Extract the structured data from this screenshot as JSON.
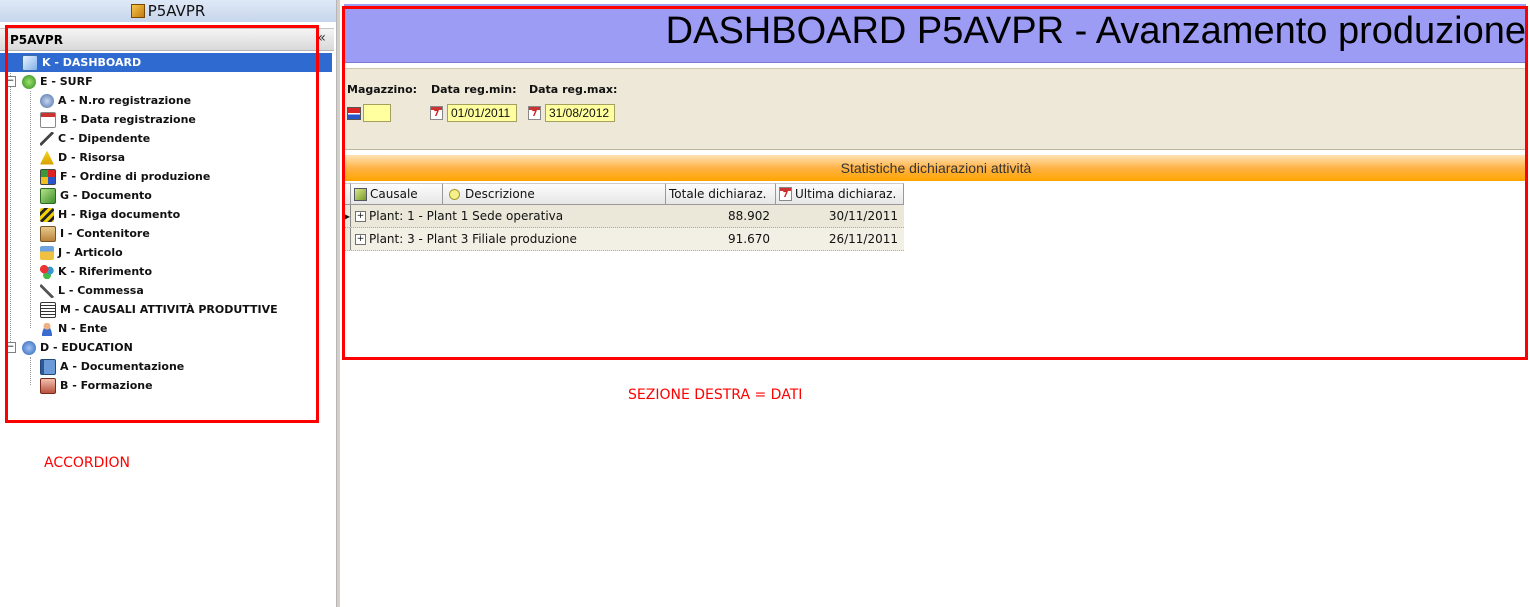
{
  "app": {
    "title": "P5AVPR"
  },
  "accordion": {
    "header_title": "P5AVPR",
    "collapse_glyph": "«",
    "annotation": "ACCORDION",
    "tree": {
      "root1": "K - DASHBOARD",
      "root2": "E - SURF",
      "surf_items": [
        "A - N.ro registrazione",
        "B - Data registrazione",
        "C - Dipendente",
        "D - Risorsa",
        "F - Ordine di produzione",
        "G - Documento",
        "H - Riga documento",
        "I - Contenitore",
        "J - Articolo",
        "K - Riferimento",
        "L - Commessa",
        "M - CAUSALI ATTIVITÀ PRODUTTIVE",
        "N - Ente"
      ],
      "root3": "D - EDUCATION",
      "edu_items": [
        "A - Documentazione",
        "B - Formazione"
      ]
    }
  },
  "dashboard": {
    "title": "DASHBOARD P5AVPR - Avanzamento produzione",
    "annotation": "SEZIONE DESTRA = DATI",
    "filters": {
      "magazzino_label": "Magazzino:",
      "magazzino_value": "",
      "data_min_label": "Data reg.min:",
      "data_min_value": "01/01/2011",
      "data_max_label": "Data reg.max:",
      "data_max_value": "31/08/2012"
    },
    "section_title": "Statistiche dichiarazioni attività",
    "grid": {
      "columns": [
        "Causale",
        "Descrizione",
        "Totale dichiaraz.",
        "Ultima dichiaraz."
      ],
      "rows": [
        {
          "label": "Plant: 1 - Plant 1 Sede operativa",
          "totale": "88.902",
          "ultima": "30/11/2011"
        },
        {
          "label": "Plant: 3 - Plant 3 Filiale produzione",
          "totale": "91.670",
          "ultima": "26/11/2011"
        }
      ]
    }
  },
  "colors": {
    "selection": "#2f6ad1",
    "title_band": "#9c9cf4",
    "annotation_red": "#ff0000",
    "section_orange": "#ffa500",
    "input_yellow": "#ffffa0"
  },
  "icons": [
    "dashboard-icon",
    "surf-icon",
    "info-icon",
    "calendar-icon",
    "warehouse-icon",
    "plus-expander-icon"
  ]
}
